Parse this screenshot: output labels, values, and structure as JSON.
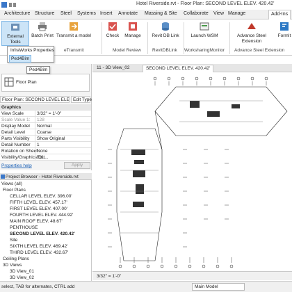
{
  "app": {
    "title": "Hotel Riverside.rvt - Floor Plan: SECOND LEVEL ELEV. 420.42'",
    "quick_access_icon": "revit-quick-access-icon"
  },
  "ribbon_tabs": [
    "Architecture",
    "Structure",
    "Steel",
    "Systems",
    "Insert",
    "Annotate",
    "Massing & Site",
    "Collaborate",
    "View",
    "Manage",
    "Add-Ins"
  ],
  "active_tab": "Add-Ins",
  "ribbon": {
    "buttons": [
      {
        "label": "External Tools",
        "icon": "external-tools-icon"
      },
      {
        "label": "Batch Print",
        "icon": "printer-icon"
      },
      {
        "label": "Transmit a model",
        "icon": "transmit-icon"
      },
      {
        "label": "Check",
        "icon": "check-icon"
      },
      {
        "label": "Manage",
        "icon": "manage-icon"
      },
      {
        "label": "Revit DB Link",
        "icon": "database-link-icon"
      },
      {
        "label": "Launch WSM",
        "icon": "launch-wsm-icon"
      },
      {
        "label": "Advance Steel Extension",
        "icon": "steel-extension-icon"
      },
      {
        "label": "FormIt",
        "icon": "formit-icon"
      }
    ],
    "groups": [
      "eTransmit",
      "Model Review",
      "RevitDBLink",
      "WorksharingMonitor",
      "Advance Steel Extension"
    ]
  },
  "external_tools_menu": {
    "items": [
      "InfraWorks Properties",
      "Ped4Bim"
    ],
    "tooltip": "Ped4Bim"
  },
  "properties": {
    "type_name": "Floor Plan",
    "instance_selector": "Floor Plan: SECOND LEVEL ELEV. 42",
    "edit_type_label": "Edit Type",
    "section": "Graphics",
    "rows": [
      {
        "key": "View Scale",
        "value": "3/32\" = 1'-0\""
      },
      {
        "key": "Scale Value 1:",
        "value": "128"
      },
      {
        "key": "Display Model",
        "value": "Normal"
      },
      {
        "key": "Detail Level",
        "value": "Coarse"
      },
      {
        "key": "Parts Visibility",
        "value": "Show Original"
      },
      {
        "key": "Detail Number",
        "value": "1"
      },
      {
        "key": "Rotation on Sheet",
        "value": "None"
      },
      {
        "key": "Visibility/Graphics O...",
        "value": "Edit..."
      }
    ],
    "help_link": "Properties help",
    "apply_label": "Apply"
  },
  "project_browser": {
    "title": "Project Browser - Hotel Riverside.rvt",
    "nodes": [
      {
        "label": "Views (all)",
        "level": 0
      },
      {
        "label": "Floor Plans",
        "level": 1
      },
      {
        "label": "CELLAR LEVEL ELEV. 396.00'",
        "level": 2
      },
      {
        "label": "FIFTH LEVEL ELEV. 457.17'",
        "level": 2
      },
      {
        "label": "FIRST LEVEL ELEV. 407.00'",
        "level": 2
      },
      {
        "label": "FOURTH LEVEL ELEV. 444.92'",
        "level": 2
      },
      {
        "label": "MAIN ROOF ELEV. 48.67'",
        "level": 2
      },
      {
        "label": "PENTHOUSE",
        "level": 2
      },
      {
        "label": "SECOND LEVEL ELEV. 420.42'",
        "level": 2,
        "selected": true
      },
      {
        "label": "Site",
        "level": 2
      },
      {
        "label": "SIXTH LEVEL ELEV. 469.42'",
        "level": 2
      },
      {
        "label": "THIRD LEVEL ELEV. 432.67'",
        "level": 2
      },
      {
        "label": "Ceiling Plans",
        "level": 1
      },
      {
        "label": "3D Views",
        "level": 1
      },
      {
        "label": "3D View_01",
        "level": 2
      },
      {
        "label": "3D View_02",
        "level": 2
      }
    ]
  },
  "view_tabs": [
    {
      "label": "11 - 3D View_02",
      "active": false
    },
    {
      "label": "SECOND LEVEL ELEV. 420.42'",
      "active": true
    }
  ],
  "view_control_bar": {
    "scale": "3/32\" = 1'-0\""
  },
  "status": {
    "text": "select, TAB for alternates, CTRL add",
    "model_selector": "Main Model"
  }
}
